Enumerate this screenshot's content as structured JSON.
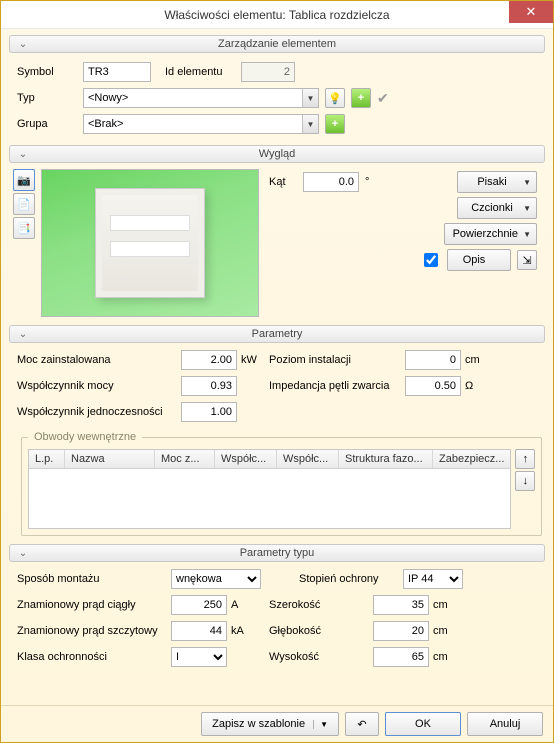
{
  "window": {
    "title": "Właściwości elementu: Tablica rozdzielcza"
  },
  "sections": {
    "zarzadzanie": "Zarządzanie elementem",
    "wyglad": "Wygląd",
    "parametry": "Parametry",
    "obwody": "Obwody wewnętrzne",
    "parametry_typu": "Parametry typu"
  },
  "zarz": {
    "symbol_label": "Symbol",
    "symbol_value": "TR3",
    "id_label": "Id elementu",
    "id_value": "2",
    "typ_label": "Typ",
    "typ_value": "<Nowy>",
    "grupa_label": "Grupa",
    "grupa_value": "<Brak>"
  },
  "wyglad": {
    "kat_label": "Kąt",
    "kat_value": "0.0",
    "kat_unit": "°",
    "pisaki": "Pisaki",
    "czcionki": "Czcionki",
    "powierzchnie": "Powierzchnie",
    "opis": "Opis",
    "opis_checked": true
  },
  "params": {
    "moc_label": "Moc zainstalowana",
    "moc_value": "2.00",
    "moc_unit": "kW",
    "wsp_mocy_label": "Współczynnik mocy",
    "wsp_mocy_value": "0.93",
    "wsp_jedn_label": "Współczynnik jednoczesności",
    "wsp_jedn_value": "1.00",
    "poziom_label": "Poziom instalacji",
    "poziom_value": "0",
    "poziom_unit": "cm",
    "imp_label": "Impedancja pętli zwarcia",
    "imp_value": "0.50",
    "imp_unit": "Ω"
  },
  "table": {
    "cols": [
      "L.p.",
      "Nazwa",
      "Moc z...",
      "Współc...",
      "Współc...",
      "Struktura fazo...",
      "Zabezpiecz..."
    ]
  },
  "typu": {
    "sposob_label": "Sposób montażu",
    "sposob_value": "wnękowa",
    "prad_ciagly_label": "Znamionowy prąd ciągły",
    "prad_ciagly_value": "250",
    "prad_ciagly_unit": "A",
    "prad_szczyt_label": "Znamionowy prąd szczytowy",
    "prad_szczyt_value": "44",
    "prad_szczyt_unit": "kA",
    "klasa_label": "Klasa ochronności",
    "klasa_value": "I",
    "stopien_label": "Stopień ochrony",
    "stopien_value": "IP 44",
    "szer_label": "Szerokość",
    "szer_value": "35",
    "gleb_label": "Głębokość",
    "gleb_value": "20",
    "wys_label": "Wysokość",
    "wys_value": "65",
    "cm": "cm"
  },
  "footer": {
    "save_template": "Zapisz w szablonie",
    "ok": "OK",
    "cancel": "Anuluj"
  }
}
